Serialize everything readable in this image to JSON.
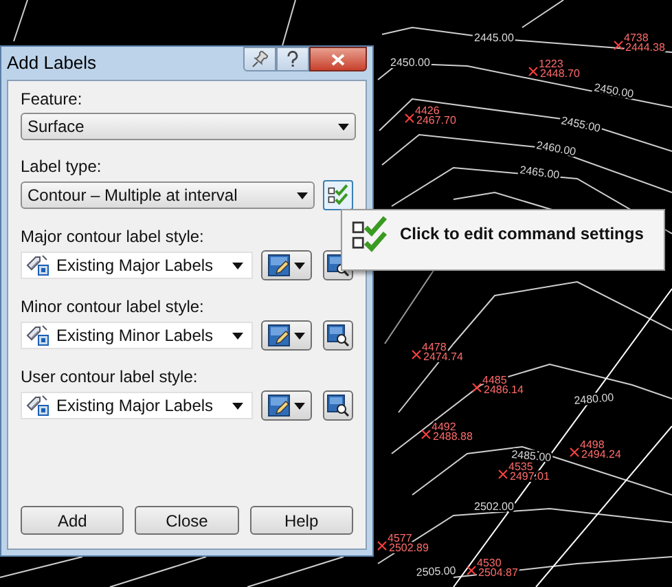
{
  "drawing": {
    "point_labels": [
      {
        "number": "4738",
        "elevation": "2444.38"
      },
      {
        "number": "1223",
        "elevation": "2448.70"
      },
      {
        "number": "4426",
        "elevation": "2467.70"
      },
      {
        "number": "4478",
        "elevation": "2474.74"
      },
      {
        "number": "4485",
        "elevation": "2486.14"
      },
      {
        "number": "4492",
        "elevation": "2488.88"
      },
      {
        "number": "4498",
        "elevation": "2494.24"
      },
      {
        "number": "4535",
        "elevation": "2497.01"
      },
      {
        "number": "4577",
        "elevation": "2502.89"
      },
      {
        "number": "4530",
        "elevation": "2504.87"
      }
    ],
    "contour_labels": [
      "2445.00",
      "2450.00",
      "2450.00",
      "2455.00",
      "2460.00",
      "2465.00",
      "2480.00",
      "2485.00",
      "2502.00",
      "2505.00"
    ]
  },
  "dialog": {
    "title": "Add Labels",
    "fields": [
      {
        "kind": "plain",
        "label": "Feature:",
        "value": "Surface"
      },
      {
        "kind": "settings",
        "label": "Label type:",
        "value": "Contour – Multiple at interval"
      },
      {
        "kind": "style",
        "label": "Major contour label style:",
        "value": "Existing Major Labels"
      },
      {
        "kind": "style",
        "label": "Minor contour label style:",
        "value": "Existing Minor Labels"
      },
      {
        "kind": "style",
        "label": "User contour label style:",
        "value": "Existing Major Labels"
      }
    ],
    "buttons": [
      "Add",
      "Close",
      "Help"
    ]
  },
  "tooltip": {
    "text": "Click to edit command settings"
  }
}
